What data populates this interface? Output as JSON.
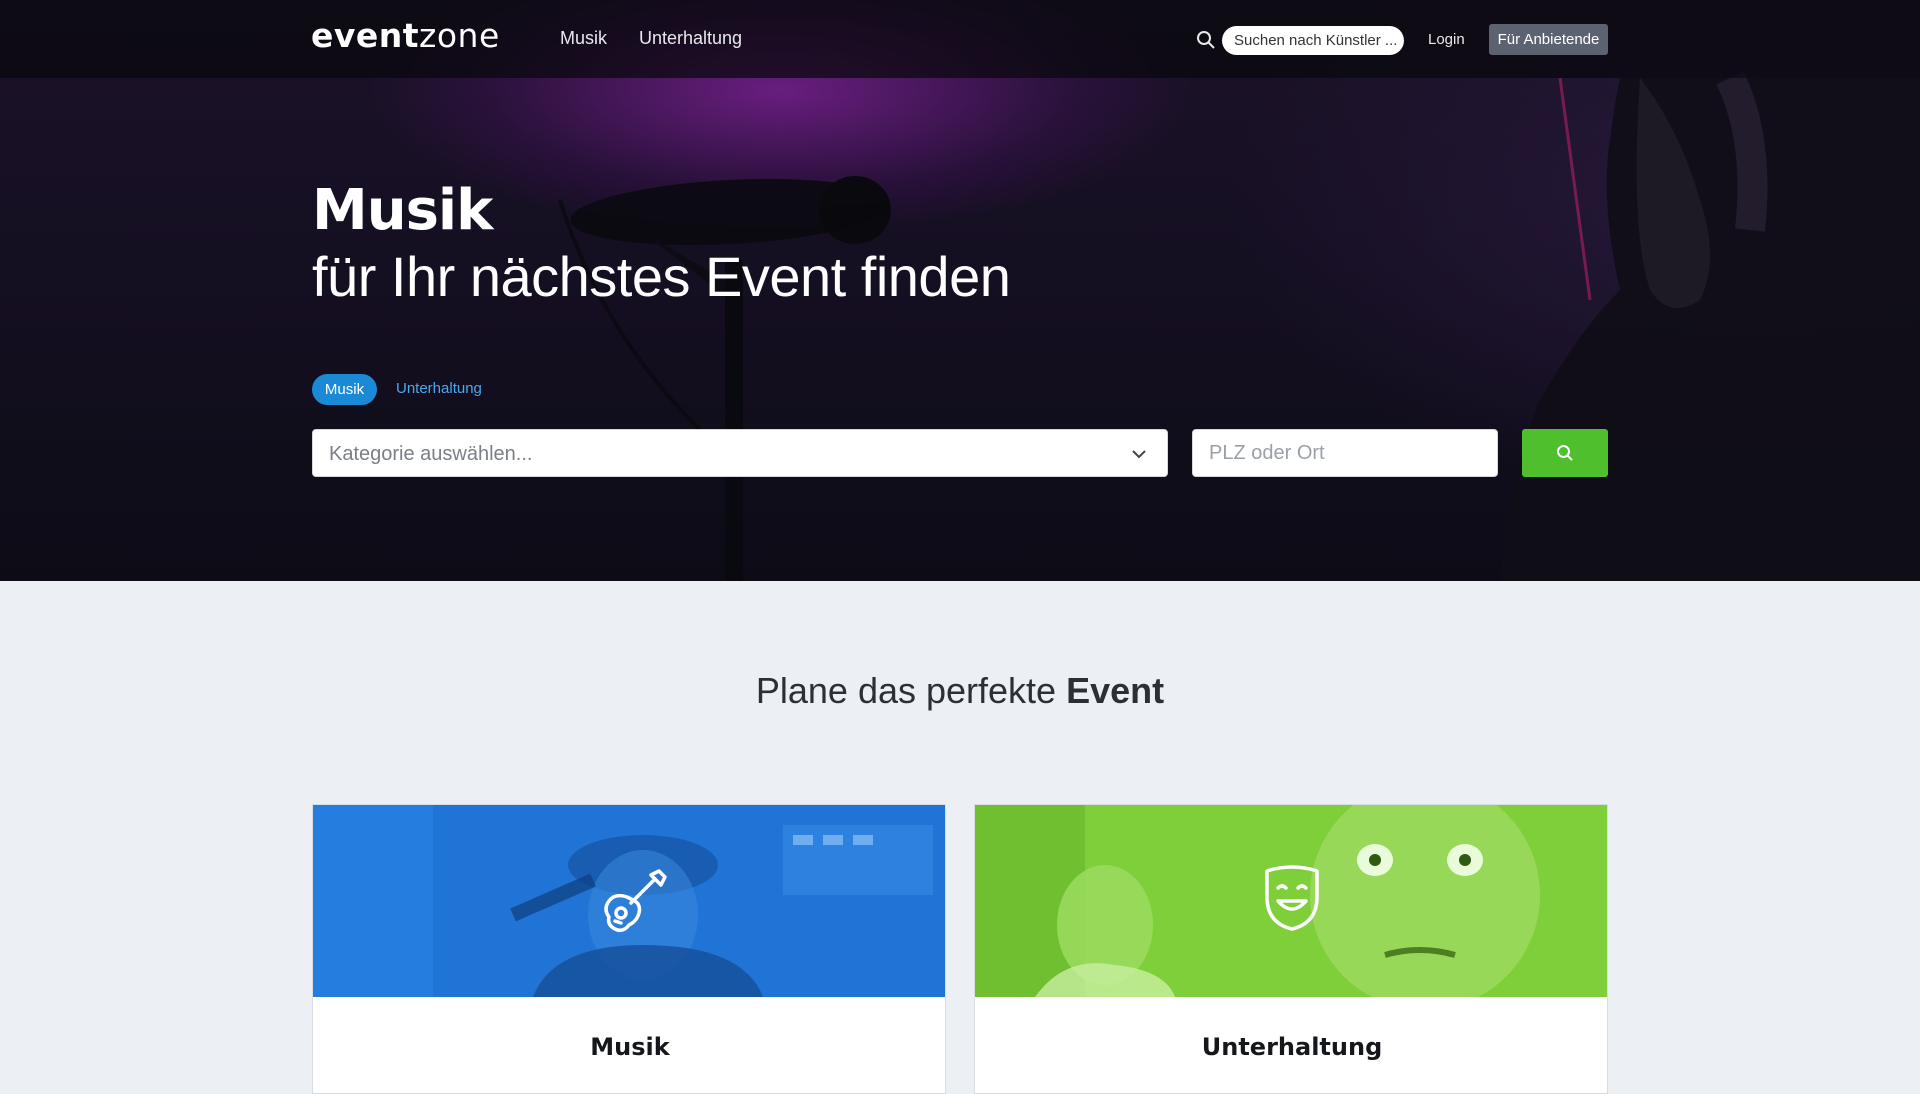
{
  "nav": {
    "logo_bold": "event",
    "logo_light": "zone",
    "links": [
      "Musik",
      "Unterhaltung"
    ],
    "search_placeholder": "Suchen nach Künstler ...",
    "login": "Login",
    "provider_button": "Für Anbietende"
  },
  "hero": {
    "title": "Musik",
    "subtitle": "für Ihr nächstes Event finden",
    "pills": {
      "active": "Musik",
      "inactive": "Unterhaltung"
    },
    "category_placeholder": "Kategorie auswählen...",
    "location_placeholder": "PLZ oder Ort",
    "search_icon": "search-icon"
  },
  "section": {
    "title_light": "Plane das perfekte ",
    "title_bold": "Event"
  },
  "cards": [
    {
      "label": "Musik",
      "icon": "guitar-icon",
      "color": "#1f74d6"
    },
    {
      "label": "Unterhaltung",
      "icon": "theater-mask-icon",
      "color": "#7fcf3a"
    }
  ],
  "colors": {
    "accent_blue": "#1a8ad6",
    "search_green": "#4fbf2e",
    "provider_button": "#5c6370"
  }
}
